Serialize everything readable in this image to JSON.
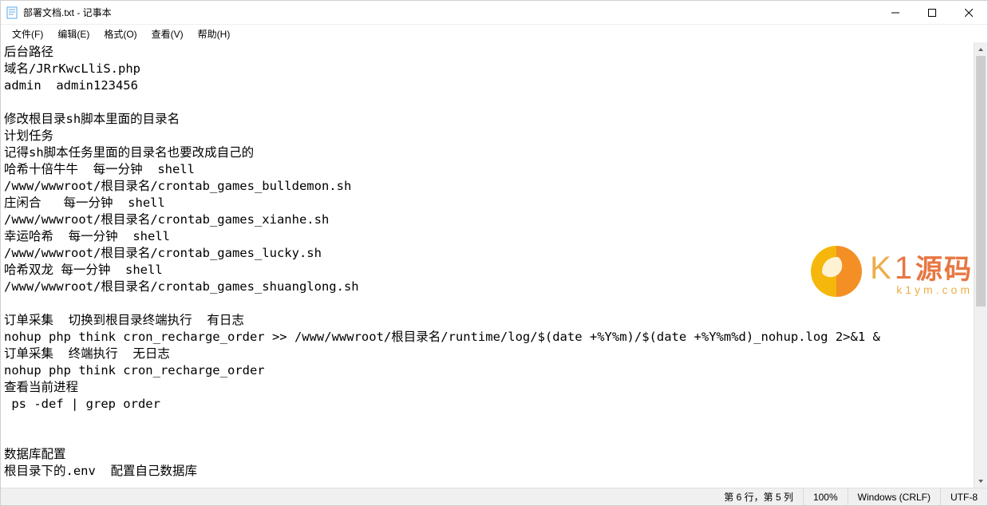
{
  "window": {
    "title": "部署文档.txt - 记事本"
  },
  "menu": {
    "file": "文件(F)",
    "edit": "编辑(E)",
    "format": "格式(O)",
    "view": "查看(V)",
    "help": "帮助(H)"
  },
  "document_text": "后台路径\n域名/JRrKwcLliS.php\nadmin  admin123456\n\n修改根目录sh脚本里面的目录名\n计划任务\n记得sh脚本任务里面的目录名也要改成自己的\n哈希十倍牛牛  每一分钟  shell\n/www/wwwroot/根目录名/crontab_games_bulldemon.sh\n庄闲合   每一分钟  shell\n/www/wwwroot/根目录名/crontab_games_xianhe.sh\n幸运哈希  每一分钟  shell\n/www/wwwroot/根目录名/crontab_games_lucky.sh\n哈希双龙 每一分钟  shell\n/www/wwwroot/根目录名/crontab_games_shuanglong.sh\n\n订单采集  切换到根目录终端执行  有日志\nnohup php think cron_recharge_order >> /www/wwwroot/根目录名/runtime/log/$(date +%Y%m)/$(date +%Y%m%d)_nohup.log 2>&1 &\n订单采集  终端执行  无日志\nnohup php think cron_recharge_order\n查看当前进程\n ps -def | grep order\n\n\n数据库配置\n根目录下的.env  配置自己数据库",
  "statusbar": {
    "position": "第 6 行，第 5 列",
    "zoom": "100%",
    "line_ending": "Windows (CRLF)",
    "encoding": "UTF-8"
  },
  "watermark": {
    "brand_k": "K",
    "brand_1": "1",
    "brand_cn": "源码",
    "url": "k1ym.com"
  }
}
